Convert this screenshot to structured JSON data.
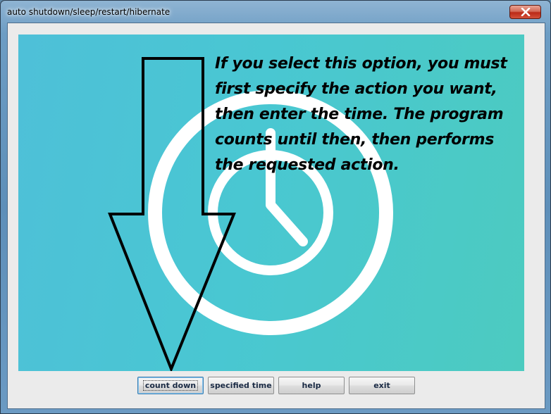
{
  "window": {
    "title": "auto shutdown/sleep/restart/hibernate",
    "close_icon": "close-icon"
  },
  "panel": {
    "background_color": "#4ac6d0",
    "illustration_icon": "clock-icon",
    "pointer_icon": "down-arrow-icon",
    "info_text": "If you select this option, you must first specify the action you want, then enter the time. The program counts until then, then performs the requested action."
  },
  "buttons": {
    "count_down": "count down",
    "specified_time": "specified time",
    "help": "help",
    "exit": "exit",
    "focused": "count_down"
  }
}
